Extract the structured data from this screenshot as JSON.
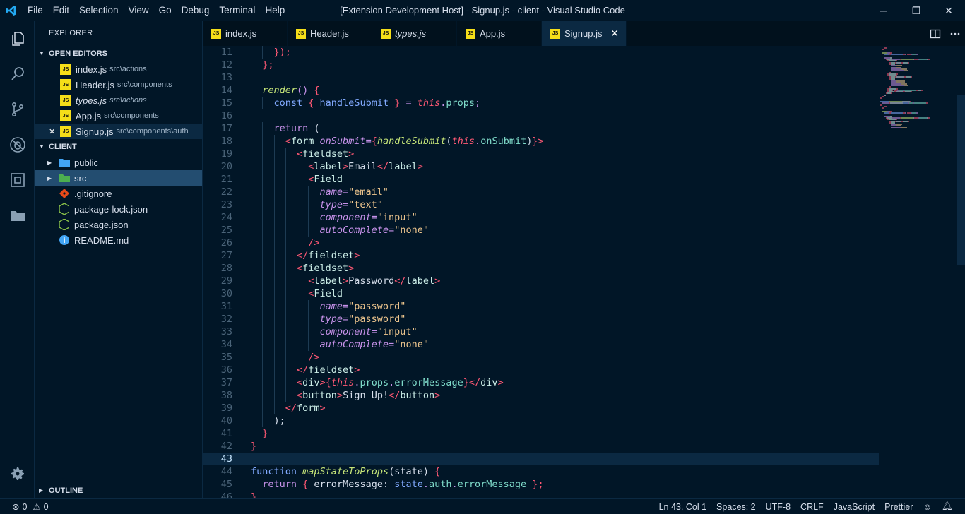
{
  "window": {
    "title": "[Extension Development Host] - Signup.js - client - Visual Studio Code",
    "menu": [
      "File",
      "Edit",
      "Selection",
      "View",
      "Go",
      "Debug",
      "Terminal",
      "Help"
    ],
    "controls": {
      "minimize": "─",
      "restore": "❐",
      "close": "✕"
    }
  },
  "activity_bar": [
    "files-icon",
    "search-icon",
    "source-control-icon",
    "debug-icon",
    "extensions-icon",
    "folder-icon",
    "gear-icon"
  ],
  "sidebar": {
    "title": "EXPLORER",
    "open_editors": {
      "header": "OPEN EDITORS",
      "items": [
        {
          "name": "index.js",
          "path": "src\\actions",
          "italic": false
        },
        {
          "name": "Header.js",
          "path": "src\\components",
          "italic": false
        },
        {
          "name": "types.js",
          "path": "src\\actions",
          "italic": true
        },
        {
          "name": "App.js",
          "path": "src\\components",
          "italic": false
        },
        {
          "name": "Signup.js",
          "path": "src\\components\\auth",
          "italic": false,
          "active": true,
          "close": "✕"
        }
      ]
    },
    "folder": {
      "header": "CLIENT",
      "items": [
        {
          "name": "public",
          "type": "folder"
        },
        {
          "name": "src",
          "type": "folder"
        },
        {
          "name": ".gitignore",
          "type": "git"
        },
        {
          "name": "package-lock.json",
          "type": "npm"
        },
        {
          "name": "package.json",
          "type": "npm"
        },
        {
          "name": "README.md",
          "type": "info"
        }
      ]
    },
    "outline": "OUTLINE"
  },
  "tabs": [
    {
      "label": "index.js",
      "italic": false
    },
    {
      "label": "Header.js",
      "italic": false
    },
    {
      "label": "types.js",
      "italic": true
    },
    {
      "label": "App.js",
      "italic": false
    },
    {
      "label": "Signup.js",
      "italic": false,
      "active": true,
      "close": "✕"
    }
  ],
  "editor": {
    "current_line": 43,
    "lines": [
      {
        "n": 11,
        "indent": 2,
        "parts": [
          [
            "red",
            "});"
          ]
        ]
      },
      {
        "n": 12,
        "indent": 1,
        "parts": [
          [
            "red",
            "};"
          ]
        ]
      },
      {
        "n": 13,
        "indent": 0,
        "parts": []
      },
      {
        "n": 14,
        "indent": 1,
        "parts": [
          [
            "fi",
            "render"
          ],
          [
            "punc",
            "() "
          ],
          [
            "red",
            "{"
          ]
        ]
      },
      {
        "n": 15,
        "indent": 2,
        "parts": [
          [
            "fn",
            "const "
          ],
          [
            "red",
            "{ "
          ],
          [
            "fn",
            "handleSubmit "
          ],
          [
            "red",
            "} "
          ],
          [
            "punc",
            "= "
          ],
          [
            "this",
            "this"
          ],
          [
            "punc",
            "."
          ],
          [
            "prop",
            "props"
          ],
          [
            "punc",
            ";"
          ]
        ]
      },
      {
        "n": 16,
        "indent": 0,
        "parts": []
      },
      {
        "n": 17,
        "indent": 2,
        "parts": [
          [
            "kw",
            "return "
          ],
          [
            "pun",
            "("
          ]
        ]
      },
      {
        "n": 18,
        "indent": 3,
        "parts": [
          [
            "red",
            "<"
          ],
          [
            "tag",
            "form "
          ],
          [
            "attr",
            "onSubmit"
          ],
          [
            "punc",
            "="
          ],
          [
            "red",
            "{"
          ],
          [
            "fi",
            "handleSubmit"
          ],
          [
            "pun",
            "("
          ],
          [
            "this",
            "this"
          ],
          [
            "punc",
            "."
          ],
          [
            "prop",
            "onSubmit"
          ],
          [
            "pun",
            ")"
          ],
          [
            "red",
            "}>"
          ]
        ]
      },
      {
        "n": 19,
        "indent": 4,
        "parts": [
          [
            "red",
            "<"
          ],
          [
            "tag",
            "fieldset"
          ],
          [
            "red",
            ">"
          ]
        ]
      },
      {
        "n": 20,
        "indent": 5,
        "parts": [
          [
            "red",
            "<"
          ],
          [
            "tag",
            "label"
          ],
          [
            "red",
            ">"
          ],
          [
            "pun",
            "Email"
          ],
          [
            "red",
            "</"
          ],
          [
            "tag",
            "label"
          ],
          [
            "red",
            ">"
          ]
        ]
      },
      {
        "n": 21,
        "indent": 5,
        "parts": [
          [
            "red",
            "<"
          ],
          [
            "tag",
            "Field"
          ]
        ]
      },
      {
        "n": 22,
        "indent": 6,
        "parts": [
          [
            "attr",
            "name"
          ],
          [
            "punc",
            "="
          ],
          [
            "str",
            "\"email\""
          ]
        ]
      },
      {
        "n": 23,
        "indent": 6,
        "parts": [
          [
            "attr",
            "type"
          ],
          [
            "punc",
            "="
          ],
          [
            "str",
            "\"text\""
          ]
        ]
      },
      {
        "n": 24,
        "indent": 6,
        "parts": [
          [
            "attr",
            "component"
          ],
          [
            "punc",
            "="
          ],
          [
            "str",
            "\"input\""
          ]
        ]
      },
      {
        "n": 25,
        "indent": 6,
        "parts": [
          [
            "attr",
            "autoComplete"
          ],
          [
            "punc",
            "="
          ],
          [
            "str",
            "\"none\""
          ]
        ]
      },
      {
        "n": 26,
        "indent": 5,
        "parts": [
          [
            "red",
            "/>"
          ]
        ]
      },
      {
        "n": 27,
        "indent": 4,
        "parts": [
          [
            "red",
            "</"
          ],
          [
            "tag",
            "fieldset"
          ],
          [
            "red",
            ">"
          ]
        ]
      },
      {
        "n": 28,
        "indent": 4,
        "parts": [
          [
            "red",
            "<"
          ],
          [
            "tag",
            "fieldset"
          ],
          [
            "red",
            ">"
          ]
        ]
      },
      {
        "n": 29,
        "indent": 5,
        "parts": [
          [
            "red",
            "<"
          ],
          [
            "tag",
            "label"
          ],
          [
            "red",
            ">"
          ],
          [
            "pun",
            "Password"
          ],
          [
            "red",
            "</"
          ],
          [
            "tag",
            "label"
          ],
          [
            "red",
            ">"
          ]
        ]
      },
      {
        "n": 30,
        "indent": 5,
        "parts": [
          [
            "red",
            "<"
          ],
          [
            "tag",
            "Field"
          ]
        ]
      },
      {
        "n": 31,
        "indent": 6,
        "parts": [
          [
            "attr",
            "name"
          ],
          [
            "punc",
            "="
          ],
          [
            "str",
            "\"password\""
          ]
        ]
      },
      {
        "n": 32,
        "indent": 6,
        "parts": [
          [
            "attr",
            "type"
          ],
          [
            "punc",
            "="
          ],
          [
            "str",
            "\"password\""
          ]
        ]
      },
      {
        "n": 33,
        "indent": 6,
        "parts": [
          [
            "attr",
            "component"
          ],
          [
            "punc",
            "="
          ],
          [
            "str",
            "\"input\""
          ]
        ]
      },
      {
        "n": 34,
        "indent": 6,
        "parts": [
          [
            "attr",
            "autoComplete"
          ],
          [
            "punc",
            "="
          ],
          [
            "str",
            "\"none\""
          ]
        ]
      },
      {
        "n": 35,
        "indent": 5,
        "parts": [
          [
            "red",
            "/>"
          ]
        ]
      },
      {
        "n": 36,
        "indent": 4,
        "parts": [
          [
            "red",
            "</"
          ],
          [
            "tag",
            "fieldset"
          ],
          [
            "red",
            ">"
          ]
        ]
      },
      {
        "n": 37,
        "indent": 4,
        "parts": [
          [
            "red",
            "<"
          ],
          [
            "tag",
            "div"
          ],
          [
            "red",
            ">{"
          ],
          [
            "this",
            "this"
          ],
          [
            "punc",
            "."
          ],
          [
            "prop",
            "props"
          ],
          [
            "punc",
            "."
          ],
          [
            "prop",
            "errorMessage"
          ],
          [
            "red",
            "}</"
          ],
          [
            "tag",
            "div"
          ],
          [
            "red",
            ">"
          ]
        ]
      },
      {
        "n": 38,
        "indent": 4,
        "parts": [
          [
            "red",
            "<"
          ],
          [
            "tag",
            "button"
          ],
          [
            "red",
            ">"
          ],
          [
            "pun",
            "Sign Up!"
          ],
          [
            "red",
            "</"
          ],
          [
            "tag",
            "button"
          ],
          [
            "red",
            ">"
          ]
        ]
      },
      {
        "n": 39,
        "indent": 3,
        "parts": [
          [
            "red",
            "</"
          ],
          [
            "tag",
            "form"
          ],
          [
            "red",
            ">"
          ]
        ]
      },
      {
        "n": 40,
        "indent": 2,
        "parts": [
          [
            "pun",
            ");"
          ]
        ]
      },
      {
        "n": 41,
        "indent": 1,
        "parts": [
          [
            "red",
            "}"
          ]
        ]
      },
      {
        "n": 42,
        "indent": 0,
        "parts": [
          [
            "red",
            "}"
          ]
        ]
      },
      {
        "n": 43,
        "indent": 0,
        "parts": []
      },
      {
        "n": 44,
        "indent": 0,
        "parts": [
          [
            "fn",
            "function "
          ],
          [
            "fi",
            "mapStateToProps"
          ],
          [
            "pun",
            "(state) "
          ],
          [
            "red",
            "{"
          ]
        ]
      },
      {
        "n": 45,
        "indent": 1,
        "parts": [
          [
            "kw",
            "return "
          ],
          [
            "red",
            "{ "
          ],
          [
            "pun",
            "errorMessage: "
          ],
          [
            "fn",
            "state"
          ],
          [
            "punc",
            "."
          ],
          [
            "prop",
            "auth"
          ],
          [
            "punc",
            "."
          ],
          [
            "prop",
            "errorMessage "
          ],
          [
            "red",
            "};"
          ]
        ]
      },
      {
        "n": 46,
        "indent": 0,
        "parts": [
          [
            "red",
            "}"
          ]
        ]
      }
    ]
  },
  "status": {
    "errors": "0",
    "warnings": "0",
    "position": "Ln 43, Col 1",
    "spaces": "Spaces: 2",
    "encoding": "UTF-8",
    "eol": "CRLF",
    "language": "JavaScript",
    "formatter": "Prettier"
  },
  "colors": {
    "background": "#011627",
    "sidebar_selected": "#0b2942",
    "folder_highlight": "#234d70",
    "keyword": "#c792ea",
    "function": "#82aaff",
    "string": "#ecc48d",
    "tag": "#caece6",
    "property": "#7fdbca",
    "brace": "#ff5874",
    "js_icon": "#f5de19"
  }
}
